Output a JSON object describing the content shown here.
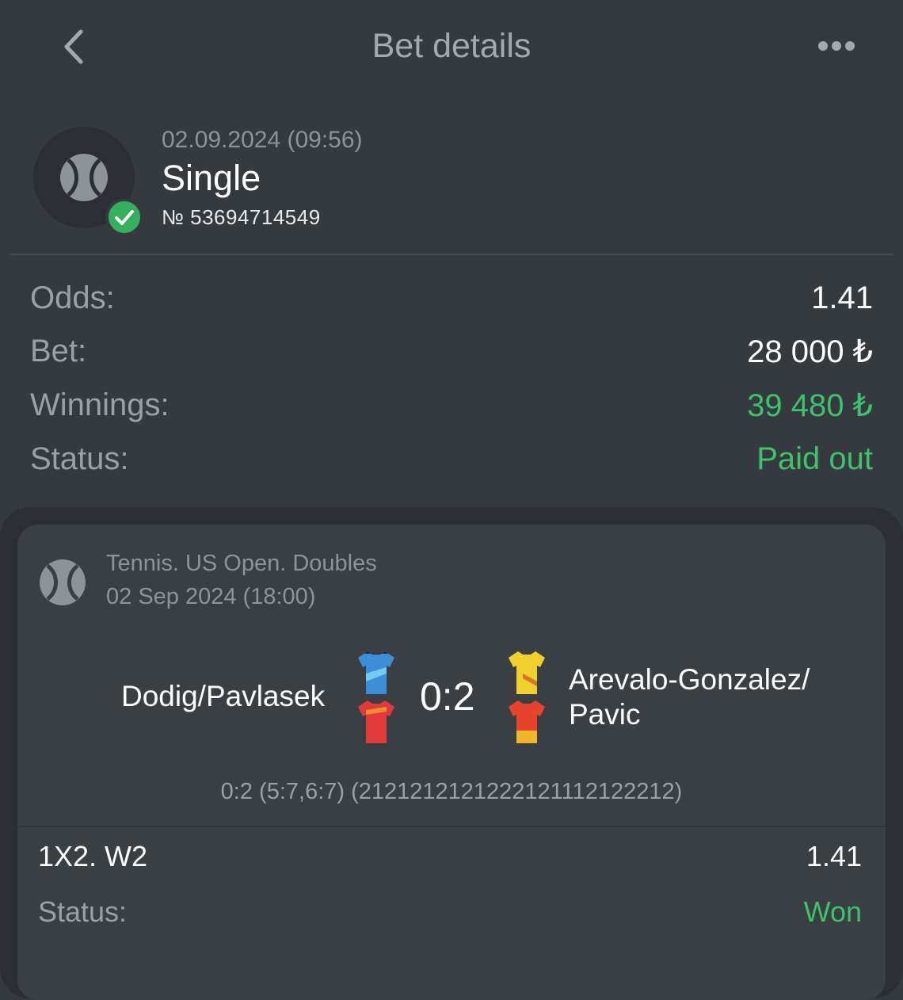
{
  "header": {
    "title": "Bet details",
    "back_icon": "chevron-left-icon",
    "more_icon": "more-dots-icon"
  },
  "bet": {
    "datetime": "02.09.2024 (09:56)",
    "type": "Single",
    "number": "№ 53694714549",
    "sport_icon": "tennis-ball-icon",
    "status_icon": "check-circle-icon"
  },
  "summary": {
    "odds_label": "Odds:",
    "odds_value": "1.41",
    "bet_label": "Bet:",
    "bet_value": "28 000 ₺",
    "winnings_label": "Winnings:",
    "winnings_value": "39 480 ₺",
    "status_label": "Status:",
    "status_value": "Paid out"
  },
  "event": {
    "league": "Tennis. US Open. Doubles",
    "date": "02 Sep 2024 (18:00)",
    "team1": "Dodig/Pavlasek",
    "team2": "Arevalo-Gonzalez/ Pavic",
    "score": "0:2",
    "sets": "0:2 (5:7,6:7) (2121212121222121112122212)",
    "market": "1X2. W2",
    "market_odds": "1.41",
    "status_label": "Status:",
    "status_value": "Won"
  },
  "colors": {
    "background": "#353a3f",
    "card": "#3a3f44",
    "accent_green": "#3dc16d",
    "muted_text": "#9aa0a6"
  }
}
